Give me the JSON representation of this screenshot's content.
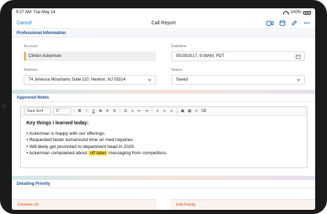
{
  "status_bar": {
    "time": "9:27 AM",
    "date": "Tue May 14",
    "battery": "100%"
  },
  "nav": {
    "cancel_label": "Cancel",
    "title": "Call Report"
  },
  "sections": {
    "professional": "Professional Information",
    "notes": "Approved Notes",
    "detailing": "Detailing Priority"
  },
  "fields": {
    "account": {
      "label": "Account",
      "value": "Clinton Ackerman"
    },
    "datetime": {
      "label": "Datetime",
      "value": "05/29/2017, 9:08AM, PDT"
    },
    "address": {
      "label": "Address",
      "value": "74 Jenessa Mountains Suite 110, Newton, NJ 03314"
    },
    "status": {
      "label": "Status",
      "value": "Saved"
    }
  },
  "toolbar": {
    "font_family": "Sans Serif",
    "font_size": "17"
  },
  "notes": {
    "heading": "Key things I learned today:",
    "bullets": [
      "Ackerman is happy with our offerings.",
      "Requested faster turnaround time on med inquiries.",
      "Will likely get promoted to department head in 2020."
    ],
    "last_bullet_pre": "Ackerman complained about ",
    "last_bullet_highlight": "off label",
    "last_bullet_post": " messaging from competitors."
  },
  "tabs": {
    "common": "Common (2)",
    "edit": "Edit Priority"
  },
  "colors": {
    "accent": "#1a73c8",
    "section_title": "#1d4f91",
    "highlight": "#fde047",
    "required_marker": "#f39c12"
  }
}
